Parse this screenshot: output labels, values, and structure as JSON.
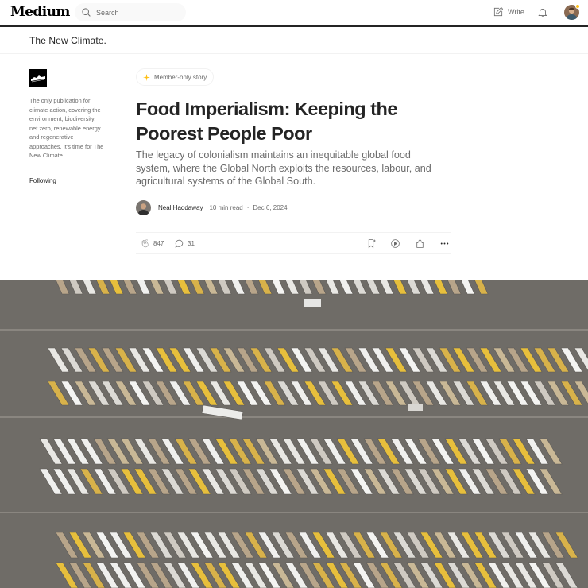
{
  "header": {
    "logo": "Medium",
    "search_placeholder": "Search",
    "write_label": "Write"
  },
  "publication": {
    "name": "The New Climate.",
    "description": "The only publication for climate action, covering the environment, biodiversity, net zero, renewable energy and regenerative approaches. It's time for The New Climate.",
    "follow_status": "Following"
  },
  "article": {
    "badge": "Member-only story",
    "title": "Food Imperialism: Keeping the Poorest People Poor",
    "subtitle": "The legacy of colonialism maintains an inequitable global food system, where the Global North exploits the resources, labour, and agricultural systems of the Global South.",
    "author": "Neal Haddaway",
    "read_time": "10 min read",
    "separator": "·",
    "date": "Dec 6, 2024",
    "claps": "847",
    "comments": "31"
  },
  "colors": {
    "accent": "#ffc017",
    "text": "#242424",
    "muted": "#6b6b6b",
    "border": "#f2f2f2"
  },
  "icons": [
    "search-icon",
    "write-icon",
    "bell-icon",
    "sparkle-icon",
    "clap-icon",
    "comment-icon",
    "bookmark-icon",
    "play-icon",
    "share-icon",
    "more-icon"
  ]
}
